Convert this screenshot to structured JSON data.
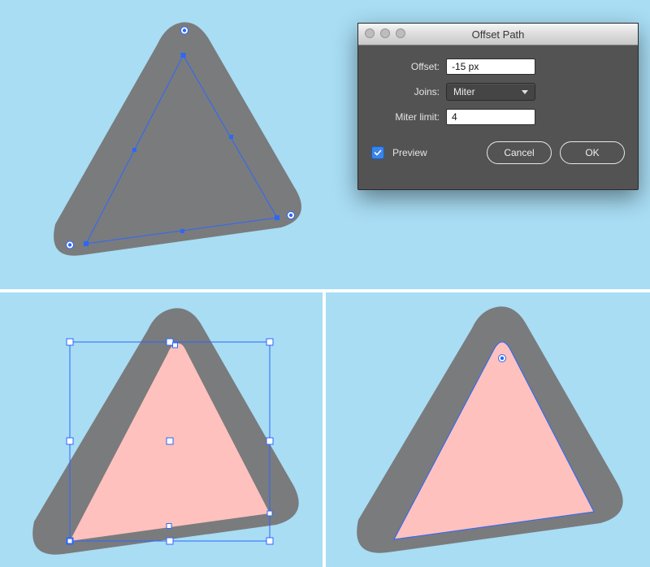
{
  "dialog": {
    "title": "Offset Path",
    "fields": {
      "offset_label": "Offset:",
      "offset_value": "-15 px",
      "joins_label": "Joins:",
      "joins_value": "Miter",
      "miter_label": "Miter limit:",
      "miter_value": "4"
    },
    "preview_label": "Preview",
    "preview_checked": true,
    "cancel_label": "Cancel",
    "ok_label": "OK"
  },
  "colors": {
    "canvas": "#a8ddf4",
    "shape_gray": "#7a7b7d",
    "shape_pink": "#fec1bd",
    "selection_blue": "#2b67ff",
    "anchor_fill": "#ffffff"
  }
}
